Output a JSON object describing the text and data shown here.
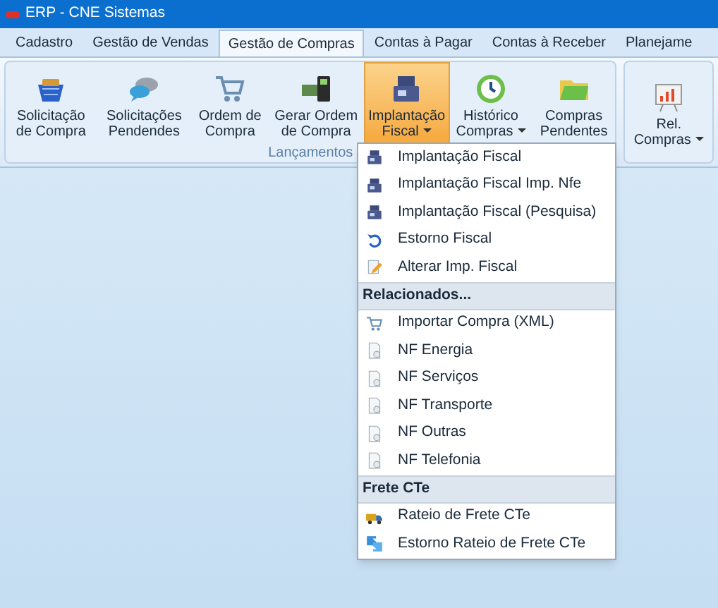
{
  "window": {
    "title": "ERP - CNE Sistemas"
  },
  "tabs": [
    {
      "label": "Cadastro",
      "selected": false
    },
    {
      "label": "Gestão de Vendas",
      "selected": false
    },
    {
      "label": "Gestão de Compras",
      "selected": true
    },
    {
      "label": "Contas à Pagar",
      "selected": false
    },
    {
      "label": "Contas à Receber",
      "selected": false
    },
    {
      "label": "Planejame",
      "selected": false
    }
  ],
  "ribbon_groups": [
    {
      "label": "Lançamentos",
      "buttons": [
        {
          "label": "Solicitação de Compra",
          "dropdown": false,
          "selected": false
        },
        {
          "label": "Solicitações Pendendes",
          "dropdown": false,
          "selected": false
        },
        {
          "label": "Ordem de Compra",
          "dropdown": false,
          "selected": false
        },
        {
          "label": "Gerar Ordem de Compra",
          "dropdown": false,
          "selected": false
        },
        {
          "label": "Implantação Fiscal",
          "dropdown": true,
          "selected": true
        },
        {
          "label": "Histórico Compras",
          "dropdown": true,
          "selected": false
        },
        {
          "label": "Compras Pendentes",
          "dropdown": false,
          "selected": false
        }
      ]
    },
    {
      "buttons": [
        {
          "label": "Rel. Compras",
          "dropdown": true,
          "selected": false
        }
      ]
    }
  ],
  "menu": [
    {
      "kind": "register",
      "label": "Implantação Fiscal"
    },
    {
      "kind": "register",
      "label": "Implantação Fiscal Imp. Nfe"
    },
    {
      "kind": "register",
      "label": "Implantação Fiscal (Pesquisa)"
    },
    {
      "kind": "undo",
      "label": "Estorno Fiscal"
    },
    {
      "kind": "edit",
      "label": "Alterar Imp. Fiscal"
    },
    {
      "kind": "header",
      "label": "Relacionados..."
    },
    {
      "kind": "cart",
      "label": "Importar Compra (XML)"
    },
    {
      "kind": "document",
      "label": "NF Energia"
    },
    {
      "kind": "document",
      "label": "NF Serviços"
    },
    {
      "kind": "document",
      "label": "NF Transporte"
    },
    {
      "kind": "document",
      "label": "NF Outras"
    },
    {
      "kind": "document",
      "label": "NF Telefonia"
    },
    {
      "kind": "header",
      "label": "Frete CTe"
    },
    {
      "kind": "truck",
      "label": "Rateio de Frete CTe"
    },
    {
      "kind": "swap",
      "label": "Estorno Rateio de Frete CTe"
    }
  ]
}
